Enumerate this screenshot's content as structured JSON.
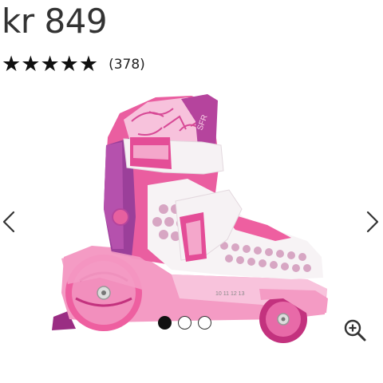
{
  "product": {
    "price": "kr 849",
    "rating": {
      "value": 5,
      "max": 5,
      "count_label": "(378)"
    }
  },
  "carousel": {
    "image_name": "roller-skate-product-image",
    "prev_icon": "chevron-left-icon",
    "next_icon": "chevron-right-icon",
    "zoom_icon": "zoom-in-icon",
    "slides": 3,
    "active_slide": 1,
    "skate_markings": {
      "brand": "SFR",
      "size_scale": "10 11 12 13"
    }
  },
  "colors": {
    "skate_pink": "#ee5fa0",
    "skate_light_pink": "#f6a7c9",
    "skate_magenta": "#c3327e",
    "skate_purple": "#8a2f8c",
    "shell_white": "#f7f4f6",
    "text": "#222222"
  }
}
